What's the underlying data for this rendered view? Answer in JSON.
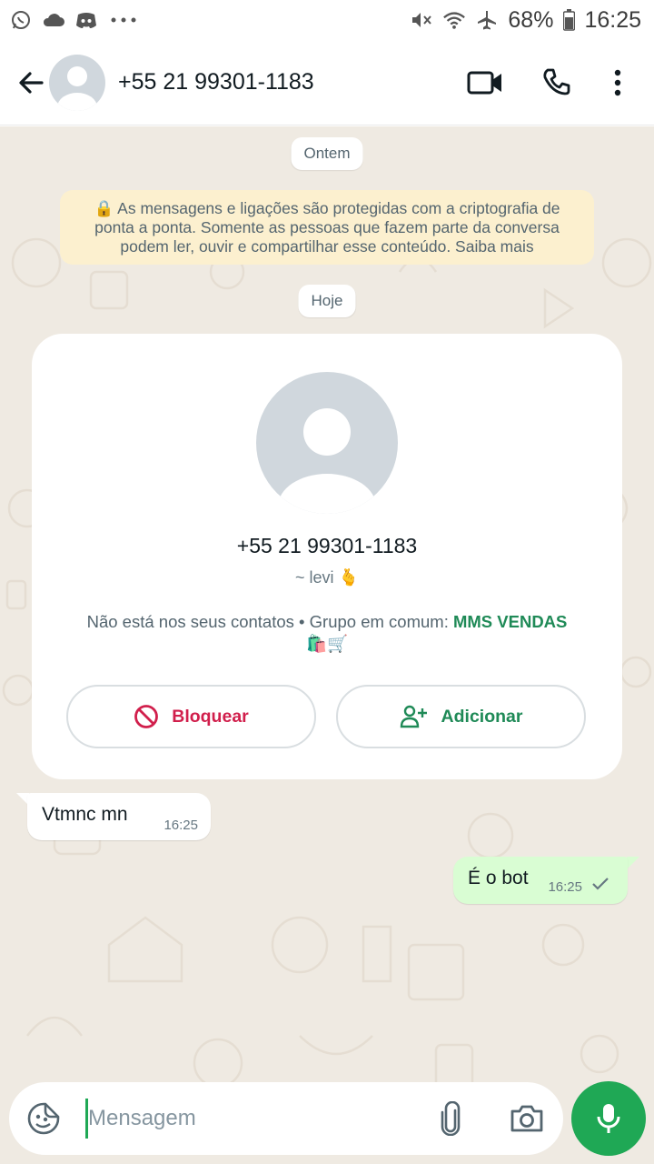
{
  "status_bar": {
    "battery": "68%",
    "time": "16:25",
    "left_icons": [
      "whatsapp-icon",
      "cloud-icon",
      "discord-icon",
      "more-dots-icon"
    ],
    "right_icons": [
      "mute-icon",
      "wifi-icon",
      "airplane-icon",
      "battery-icon"
    ]
  },
  "header": {
    "title": "+55 21 99301-1183",
    "icons": [
      "back-arrow-icon",
      "video-call-icon",
      "phone-icon",
      "more-vert-icon"
    ]
  },
  "chat": {
    "date_chip_1": "Ontem",
    "encryption_notice": "🔒 As mensagens e ligações são protegidas com a criptografia de ponta a ponta. Somente as pessoas que fazem parte da conversa podem ler, ouvir e compartilhar esse conteúdo. Saiba mais",
    "date_chip_2": "Hoje",
    "contact_card": {
      "phone": "+55 21 99301-1183",
      "name": "~ levi 🫰",
      "info_prefix": "Não está nos seus contatos • Grupo em comum: ",
      "group_name": "MMS VENDAS",
      "group_emojis": "🛍️🛒",
      "block_label": "Bloquear",
      "add_label": "Adicionar"
    },
    "messages": [
      {
        "direction": "in",
        "text": "Vtmnc mn",
        "time": "16:25"
      },
      {
        "direction": "out",
        "text": "É o bot",
        "time": "16:25",
        "status": "sent"
      }
    ]
  },
  "composer": {
    "placeholder": "Mensagem",
    "icons": [
      "sticker-icon",
      "attach-icon",
      "camera-icon",
      "mic-icon"
    ]
  },
  "colors": {
    "accent_green": "#1fa855",
    "chat_bg": "#efeae2",
    "outgoing_bubble": "#d9fdd3",
    "notice_bg": "#fcf0cf",
    "block_red": "#d11f4c",
    "group_green": "#1f8a57"
  }
}
